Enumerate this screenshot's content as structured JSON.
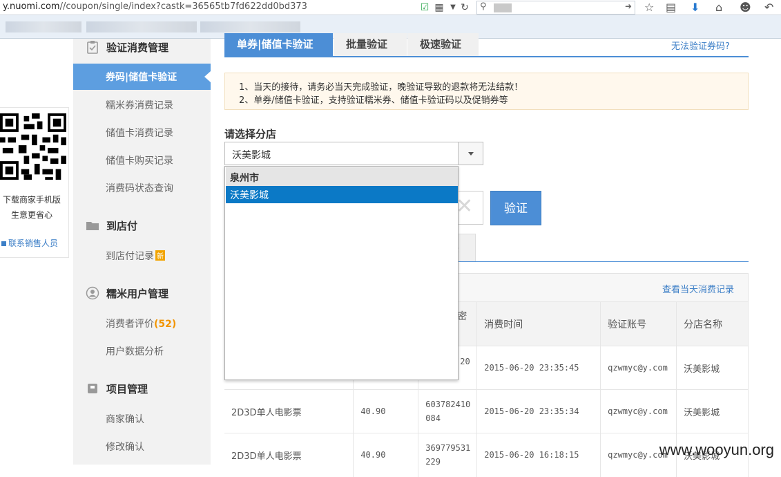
{
  "browser": {
    "url_prefix": "y.nuomi.com",
    "url_rest": "//coupon/single/index?castk=36565tb7fd622dd0bd373",
    "icons": [
      "shield-check-icon",
      "qr-icon",
      "dropdown-icon",
      "refresh-icon",
      "search-icon",
      "arrow-right-icon",
      "star-icon",
      "clipboard-icon",
      "download-icon",
      "home-icon",
      "smiley-icon",
      "back-icon"
    ]
  },
  "qr_panel": {
    "line1": "下载商家手机版",
    "line2": "生意更省心",
    "contact": "联系销售人员"
  },
  "sidebar": {
    "section_verify": "验证消费管理",
    "active_item": "券码|储值卡验证",
    "items_verify": [
      "糯米券消费记录",
      "储值卡消费记录",
      "储值卡购买记录",
      "消费码状态查询"
    ],
    "section_pay": "到店付",
    "pay_record": "到店付记录",
    "new_badge": "新",
    "section_users": "糯米用户管理",
    "consumer_review": "消费者评价",
    "review_count": "(52)",
    "user_analysis": "用户数据分析",
    "section_project": "项目管理",
    "merchant_confirm": "商家确认",
    "modify_confirm": "修改确认"
  },
  "tabs": {
    "tab1": "单券|储值卡验证",
    "tab2": "批量验证",
    "tab3": "极速验证",
    "cant_verify": "无法验证券码?"
  },
  "notice": {
    "line1": "1、当天的接待，请务必当天完成验证，晚验证导致的退款将无法结款！",
    "line2": "2、单券/储值卡验证，支持验证糯米券、储值卡验证码以及促销券等"
  },
  "store": {
    "label": "请选择分店",
    "selected": "沃美影城",
    "dropdown_group": "泉州市",
    "dropdown_option": "沃美影城"
  },
  "verify": {
    "button": "验证",
    "subtab_partial": "录"
  },
  "records": {
    "view_today": "查看当天消费记录",
    "headers": [
      "",
      "",
      "密",
      "消费时间",
      "验证账号",
      "分店名称"
    ],
    "rows": [
      [
        "",
        "",
        "20",
        "2015-06-20 23:35:45",
        "qzwmyc@y.com",
        "沃美影城"
      ],
      [
        "2D3D单人电影票",
        "40.90",
        "603782410 084",
        "2015-06-20 23:35:34",
        "qzwmyc@y.com",
        "沃美影城"
      ],
      [
        "2D3D单人电影票",
        "40.90",
        "369779531 229",
        "2015-06-20 16:18:15",
        "qzwmyc@y.com",
        "沃美影城"
      ]
    ]
  },
  "watermark": "www.wooyun.org",
  "colors": {
    "accent": "#4c8ed6",
    "sidebar_active": "#5d9ee0",
    "dropdown_highlight": "#0b79c6",
    "badge": "#f2a400",
    "notice_bg": "#fff8ed"
  }
}
